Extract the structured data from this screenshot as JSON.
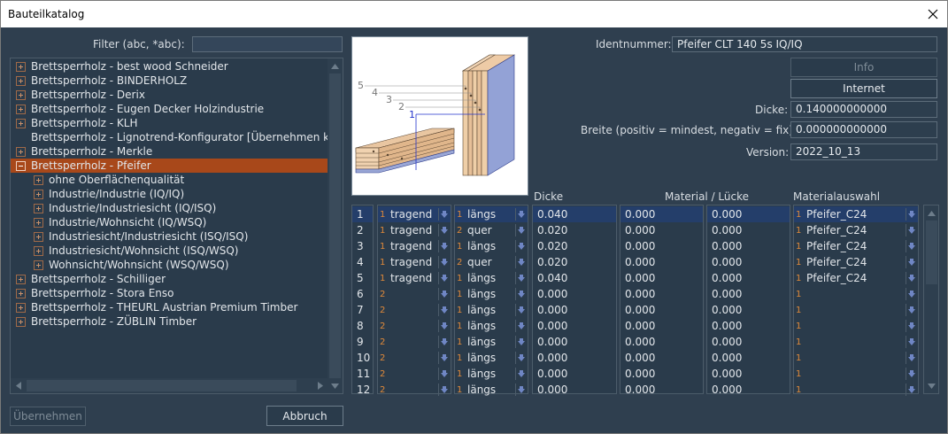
{
  "window": {
    "title": "Bauteilkatalog"
  },
  "filter": {
    "label": "Filter (abc, *abc):",
    "value": ""
  },
  "tree": {
    "items": [
      {
        "label": "Brettsperrholz - best wood Schneider",
        "expander": "plus",
        "level": 0
      },
      {
        "label": "Brettsperrholz - BINDERHOLZ",
        "expander": "plus",
        "level": 0
      },
      {
        "label": "Brettsperrholz - Derix",
        "expander": "plus",
        "level": 0
      },
      {
        "label": "Brettsperrholz - Eugen Decker Holzindustrie",
        "expander": "plus",
        "level": 0
      },
      {
        "label": "Brettsperrholz - KLH",
        "expander": "plus",
        "level": 0
      },
      {
        "label": "Brettsperrholz - Lignotrend-Konfigurator [Übernehmen klic",
        "expander": "none",
        "level": 0
      },
      {
        "label": "Brettsperrholz - Merkle",
        "expander": "plus",
        "level": 0
      },
      {
        "label": "Brettsperrholz - Pfeifer",
        "expander": "minus",
        "level": 0,
        "selected": true
      },
      {
        "label": "ohne Oberflächenqualität",
        "expander": "plus",
        "level": 1
      },
      {
        "label": "Industrie/Industrie (IQ/IQ)",
        "expander": "plus",
        "level": 1
      },
      {
        "label": "Industrie/Industriesicht (IQ/ISQ)",
        "expander": "plus",
        "level": 1
      },
      {
        "label": "Industrie/Wohnsicht (IQ/WSQ)",
        "expander": "plus",
        "level": 1
      },
      {
        "label": "Industriesicht/Industriesicht (ISQ/ISQ)",
        "expander": "plus",
        "level": 1
      },
      {
        "label": "Industriesicht/Wohnsicht (ISQ/WSQ)",
        "expander": "plus",
        "level": 1
      },
      {
        "label": "Wohnsicht/Wohnsicht (WSQ/WSQ)",
        "expander": "plus",
        "level": 1
      },
      {
        "label": "Brettsperrholz - Schilliger",
        "expander": "plus",
        "level": 0
      },
      {
        "label": "Brettsperrholz - Stora Enso",
        "expander": "plus",
        "level": 0
      },
      {
        "label": "Brettsperrholz - THEURL Austrian Premium Timber",
        "expander": "plus",
        "level": 0
      },
      {
        "label": "Brettsperrholz - ZÜBLIN Timber",
        "expander": "plus",
        "level": 0
      }
    ]
  },
  "preview": {
    "layer_labels": [
      "5",
      "4",
      "3",
      "2",
      "1"
    ]
  },
  "details": {
    "ident_label": "Identnummer:",
    "ident_value": "Pfeifer CLT 140 5s  IQ/IQ",
    "info_button": "Info",
    "internet_button": "Internet",
    "dicke_label": "Dicke:",
    "dicke_value": "0.140000000000",
    "breite_label": "Breite (positiv = mindest, negativ = fix):",
    "breite_value": "0.000000000000",
    "version_label": "Version:",
    "version_value": "2022_10_13"
  },
  "grid": {
    "headers": {
      "dicke": "Dicke",
      "material_luecke": "Material / Lücke",
      "materialauswahl": "Materialauswahl"
    },
    "rows": [
      {
        "n": "1",
        "f_num": "1",
        "function": "tragend",
        "d_num": "1",
        "direction": "längs",
        "dicke": "0.040",
        "material": "0.000",
        "luecke": "0.000",
        "m_num": "1",
        "materialauswahl": "Pfeifer_C24"
      },
      {
        "n": "2",
        "f_num": "1",
        "function": "tragend",
        "d_num": "2",
        "direction": "quer",
        "dicke": "0.020",
        "material": "0.000",
        "luecke": "0.000",
        "m_num": "1",
        "materialauswahl": "Pfeifer_C24"
      },
      {
        "n": "3",
        "f_num": "1",
        "function": "tragend",
        "d_num": "1",
        "direction": "längs",
        "dicke": "0.020",
        "material": "0.000",
        "luecke": "0.000",
        "m_num": "1",
        "materialauswahl": "Pfeifer_C24"
      },
      {
        "n": "4",
        "f_num": "1",
        "function": "tragend",
        "d_num": "2",
        "direction": "quer",
        "dicke": "0.020",
        "material": "0.000",
        "luecke": "0.000",
        "m_num": "1",
        "materialauswahl": "Pfeifer_C24"
      },
      {
        "n": "5",
        "f_num": "1",
        "function": "tragend",
        "d_num": "1",
        "direction": "längs",
        "dicke": "0.040",
        "material": "0.000",
        "luecke": "0.000",
        "m_num": "1",
        "materialauswahl": "Pfeifer_C24"
      },
      {
        "n": "6",
        "f_num": "2",
        "function": "",
        "d_num": "1",
        "direction": "längs",
        "dicke": "0.000",
        "material": "0.000",
        "luecke": "0.000",
        "m_num": "1",
        "materialauswahl": ""
      },
      {
        "n": "7",
        "f_num": "2",
        "function": "",
        "d_num": "1",
        "direction": "längs",
        "dicke": "0.000",
        "material": "0.000",
        "luecke": "0.000",
        "m_num": "1",
        "materialauswahl": ""
      },
      {
        "n": "8",
        "f_num": "2",
        "function": "",
        "d_num": "1",
        "direction": "längs",
        "dicke": "0.000",
        "material": "0.000",
        "luecke": "0.000",
        "m_num": "1",
        "materialauswahl": ""
      },
      {
        "n": "9",
        "f_num": "2",
        "function": "",
        "d_num": "1",
        "direction": "längs",
        "dicke": "0.000",
        "material": "0.000",
        "luecke": "0.000",
        "m_num": "1",
        "materialauswahl": ""
      },
      {
        "n": "10",
        "f_num": "2",
        "function": "",
        "d_num": "1",
        "direction": "längs",
        "dicke": "0.000",
        "material": "0.000",
        "luecke": "0.000",
        "m_num": "1",
        "materialauswahl": ""
      },
      {
        "n": "11",
        "f_num": "2",
        "function": "",
        "d_num": "1",
        "direction": "längs",
        "dicke": "0.000",
        "material": "0.000",
        "luecke": "0.000",
        "m_num": "1",
        "materialauswahl": ""
      },
      {
        "n": "12",
        "f_num": "2",
        "function": "",
        "d_num": "1",
        "direction": "längs",
        "dicke": "0.000",
        "material": "0.000",
        "luecke": "0.000",
        "m_num": "1",
        "materialauswahl": ""
      }
    ]
  },
  "buttons": {
    "uebernehmen": "Übernehmen",
    "abbruch": "Abbruch"
  },
  "icons": {
    "close": "close-icon",
    "expand": "plus-box-icon",
    "collapse": "minus-box-icon",
    "dropdown": "arrow-down-icon"
  },
  "colors": {
    "selection": "#a8481a",
    "grid_selection": "#243e6a",
    "accent_number": "#e08a3a"
  }
}
